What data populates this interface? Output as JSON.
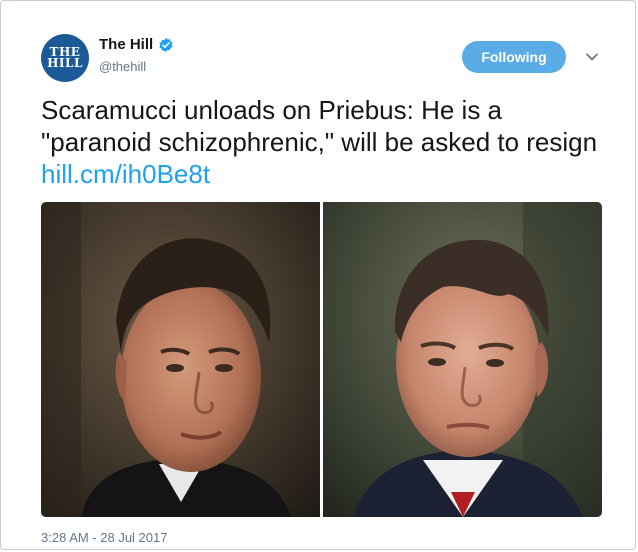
{
  "account": {
    "name": "The Hill",
    "handle": "@thehill",
    "avatar_text_line1": "THE",
    "avatar_text_line2": "HILL",
    "avatar_color": "#1b5a96",
    "verified_icon": "verified-badge-icon"
  },
  "follow_button": {
    "label": "Following",
    "color": "#5aace6"
  },
  "menu_icon": "chevron-down-icon",
  "tweet": {
    "text": "Scaramucci unloads on Priebus: He is a \"paranoid schizophrenic,\" will be asked to resign ",
    "link_text": "hill.cm/ih0Be8t",
    "link_color": "#1da1f2"
  },
  "media": {
    "left_photo": "portrait-photo",
    "right_photo": "portrait-photo"
  },
  "timestamp": "3:28 AM - 28 Jul 2017"
}
